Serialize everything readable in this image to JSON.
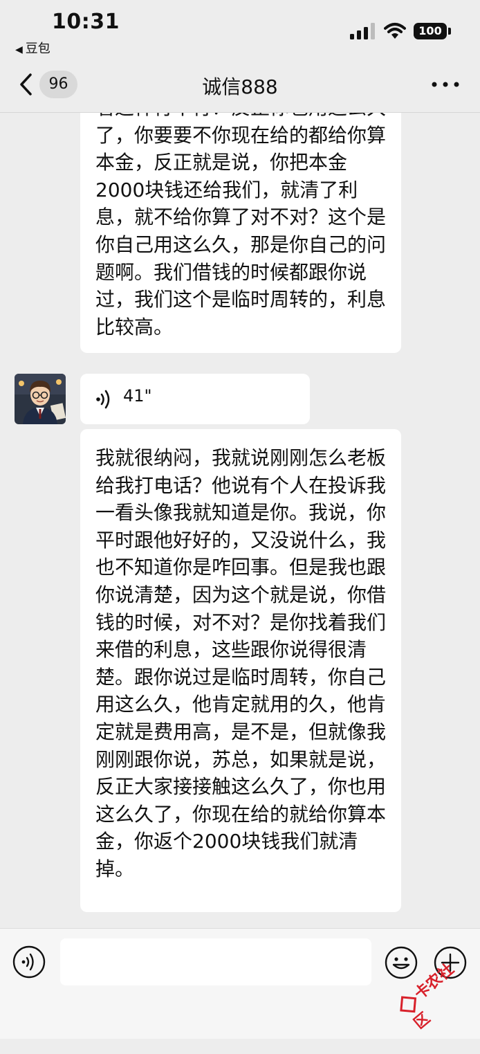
{
  "status_bar": {
    "time": "10:31",
    "back_app": "豆包",
    "battery": "100"
  },
  "nav": {
    "unread_count": "96",
    "title": "诚信888"
  },
  "messages": [
    {
      "type": "text",
      "text": "看这样行不行？反正你也用这么久了，你要要不你现在给的都给你算本金，反正就是说，你把本金2000块钱还给我们，就清了利息，就不给你算了对不对？这个是你自己用这么久，那是你自己的问题啊。我们借钱的时候都跟你说过，我们这个是临时周转的，利息比较高。"
    },
    {
      "type": "voice",
      "duration": "41\""
    },
    {
      "type": "text",
      "text": "我就很纳闷，我就说刚刚怎么老板给我打电话？他说有个人在投诉我一看头像我就知道是你。我说，你平时跟他好好的，又没说什么，我也不知道你是咋回事。但是我也跟你说清楚，因为这个就是说，你借钱的时候，对不对？是你找着我们来借的利息，这些跟你说得很清楚。跟你说过是临时周转，你自己用这么久，他肯定就用的久，他肯定就是费用高，是不是，但就像我刚刚跟你说，苏总，如果就是说，反正大家接接触这么久了，你也用这么久了，你现在给的就给你算本金，你返个2000块钱我们就清掉。"
    }
  ],
  "input_bar": {
    "value": ""
  },
  "watermark": "卡农社区",
  "icons": [
    "signal-icon",
    "wifi-icon",
    "battery-icon",
    "back-icon",
    "more-icon",
    "voice-wave-icon",
    "voice-input-icon",
    "emoji-icon",
    "plus-icon"
  ],
  "colors": {
    "background": "#ededed",
    "bubble": "#ffffff",
    "watermark": "#d8202a"
  }
}
